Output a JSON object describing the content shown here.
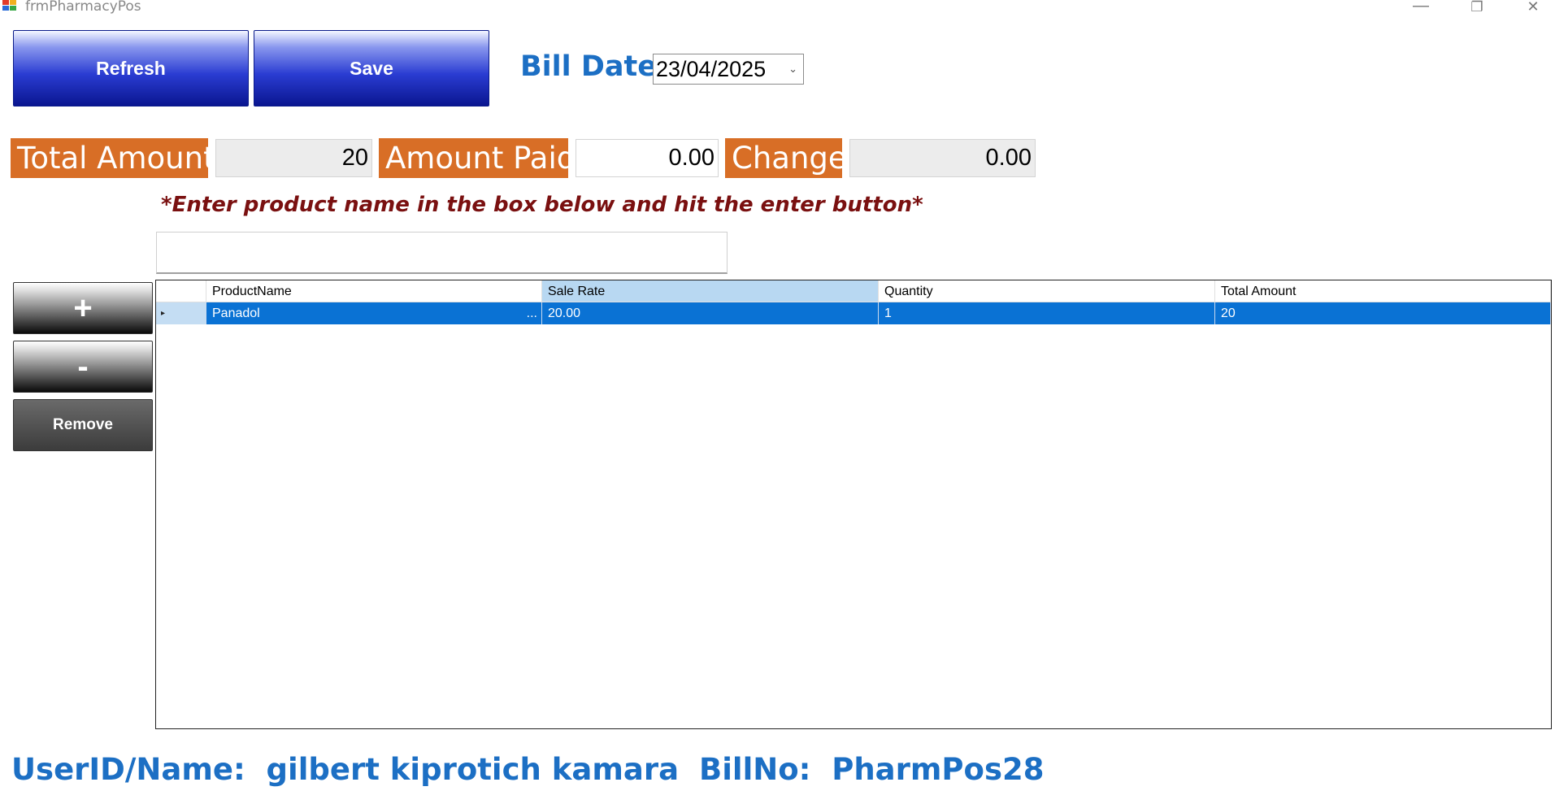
{
  "window": {
    "title": "frmPharmacyPos",
    "controls": {
      "minimize": "—",
      "restore": "❐",
      "close": "✕"
    }
  },
  "toolbar": {
    "refresh_label": "Refresh",
    "save_label": "Save"
  },
  "bill_date": {
    "label": "Bill Date:",
    "value": "23/04/2025"
  },
  "totals": {
    "total_amount_label": "Total Amount",
    "total_amount_value": "20",
    "amount_paid_label": "Amount Paid",
    "amount_paid_value": "0.00",
    "change_label": "Change",
    "change_value": "0.00"
  },
  "search": {
    "hint": "*Enter product name in the box below and hit the enter button*",
    "value": ""
  },
  "side_buttons": {
    "plus_label": "+",
    "minus_label": "-",
    "remove_label": "Remove"
  },
  "grid": {
    "columns": [
      "ProductName",
      "Sale Rate",
      "Quantity",
      "Total Amount"
    ],
    "selected_column": "Sale Rate",
    "rows": [
      {
        "product_name": "Panadol",
        "sale_rate": "20.00",
        "quantity": "1",
        "total_amount": "20",
        "ellipsis": "..."
      }
    ]
  },
  "footer": {
    "user_label": "UserID/Name:",
    "user_value": "gilbert kiprotich kamara",
    "bill_label": "BillNo:",
    "bill_value": "PharmPos28"
  },
  "colors": {
    "accent_blue": "#1c6fc4",
    "label_orange": "#d86e26",
    "hint_red": "#7a1010",
    "selection_blue": "#0a72d4"
  }
}
